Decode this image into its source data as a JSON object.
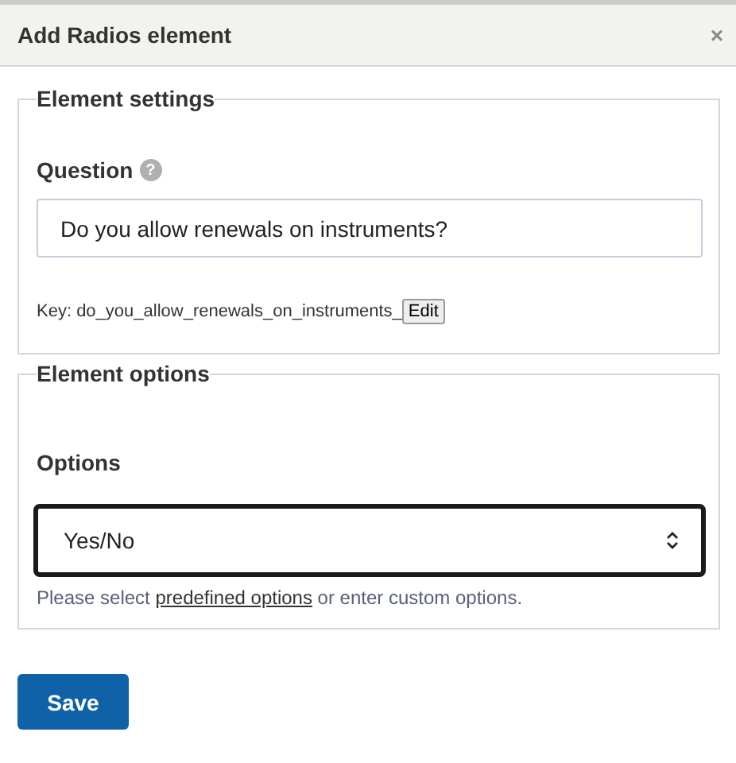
{
  "dialog": {
    "title": "Add Radios element",
    "close": "×"
  },
  "settings": {
    "legend": "Element settings",
    "question_label": "Question",
    "help": "?",
    "question_value": "Do you allow renewals on instruments?",
    "key_prefix": "Key: do_you_allow_renewals_on_instruments_",
    "edit_button": "Edit"
  },
  "options": {
    "legend": "Element options",
    "label": "Options",
    "select_value": "Yes/No",
    "focused": true,
    "hint_before": "Please select ",
    "hint_link": "predefined options",
    "hint_after": " or enter custom options."
  },
  "buttons": [
    "Save"
  ]
}
